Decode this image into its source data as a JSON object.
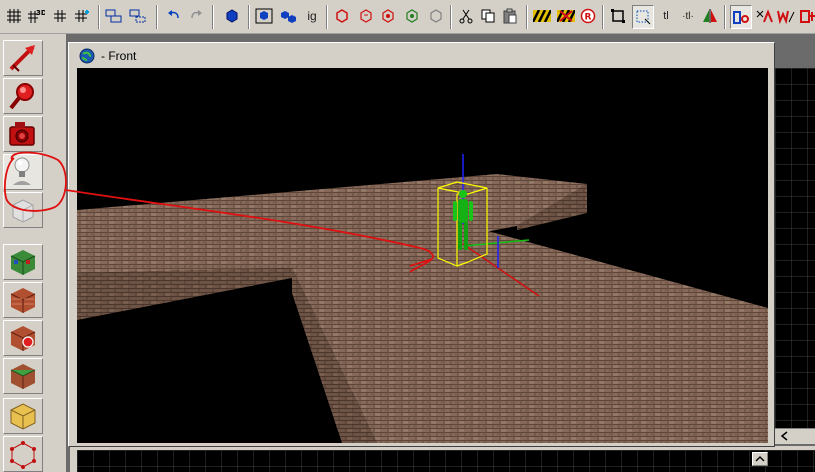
{
  "toolbar": {
    "items": [
      {
        "name": "grid-icon"
      },
      {
        "name": "grid-3d-icon",
        "label": "3D"
      },
      {
        "name": "grid-small-icon"
      },
      {
        "name": "grid-snap-icon"
      },
      {
        "name": "group-icon"
      },
      {
        "name": "ungroup-icon"
      },
      {
        "name": "undo-icon"
      },
      {
        "name": "redo-icon"
      },
      {
        "name": "cube-blue-icon"
      },
      {
        "name": "select-all-icon"
      },
      {
        "name": "select-objects-icon"
      },
      {
        "name": "ignore-icon",
        "label": "ig"
      },
      {
        "name": "cube-red-icon"
      },
      {
        "name": "cube-copy-icon"
      },
      {
        "name": "cube-paint-icon"
      },
      {
        "name": "cube-texture-icon"
      },
      {
        "name": "cube-gray-icon"
      },
      {
        "name": "cut-icon"
      },
      {
        "name": "copy-icon"
      },
      {
        "name": "paste-icon"
      },
      {
        "name": "hazard-icon"
      },
      {
        "name": "hazard-x-icon"
      },
      {
        "name": "record-icon",
        "label": "R"
      },
      {
        "name": "box-select-icon"
      },
      {
        "name": "dotted-select-icon"
      },
      {
        "name": "text-align-icon",
        "label": "tl"
      },
      {
        "name": "text-center-icon",
        "label": "·tl·"
      },
      {
        "name": "flip-icon"
      },
      {
        "name": "mode-c-icon"
      },
      {
        "name": "mode-a-icon"
      },
      {
        "name": "mode-w-icon"
      },
      {
        "name": "mode-f-icon"
      }
    ]
  },
  "left_tools": [
    {
      "name": "arrow-tool-icon"
    },
    {
      "name": "magnify-tool-icon"
    },
    {
      "name": "camera-tool-icon"
    },
    {
      "name": "light-entity-tool-icon"
    },
    {
      "name": "block-tool-icon"
    },
    {
      "name": "texture-apply-tool-icon"
    },
    {
      "name": "brick-texture-tool-icon"
    },
    {
      "name": "decal-tool-icon"
    },
    {
      "name": "overlay-tool-icon"
    },
    {
      "name": "cordon-tool-icon"
    },
    {
      "name": "vertex-tool-icon"
    }
  ],
  "viewport": {
    "title": "- Front",
    "annotation_color": "#e01010"
  },
  "colors": {
    "background": "#d4d0c8",
    "viewport_bg": "#000000",
    "brick": "#8a6c5c",
    "entity_green": "#18c418",
    "bbox_yellow": "#ffff00"
  }
}
